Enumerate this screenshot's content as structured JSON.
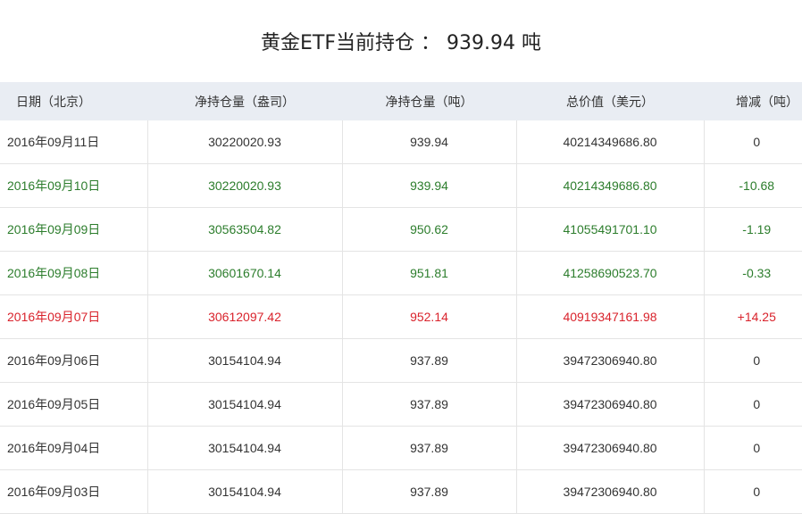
{
  "page_title": "黄金ETF当前持仓 ： 939.94 吨",
  "colors": {
    "header_bg": "#e9edf3",
    "decrease": "#2c7d2c",
    "increase": "#d9232c",
    "neutral": "#333333"
  },
  "table": {
    "headers": [
      "日期（北京）",
      "净持仓量（盎司）",
      "净持仓量（吨）",
      "总价值（美元）",
      "增减（吨）"
    ],
    "rows": [
      {
        "trend": "neutral",
        "cells": [
          "2016年09月11日",
          "30220020.93",
          "939.94",
          "40214349686.80",
          "0"
        ]
      },
      {
        "trend": "down",
        "cells": [
          "2016年09月10日",
          "30220020.93",
          "939.94",
          "40214349686.80",
          "-10.68"
        ]
      },
      {
        "trend": "down",
        "cells": [
          "2016年09月09日",
          "30563504.82",
          "950.62",
          "41055491701.10",
          "-1.19"
        ]
      },
      {
        "trend": "down",
        "cells": [
          "2016年09月08日",
          "30601670.14",
          "951.81",
          "41258690523.70",
          "-0.33"
        ]
      },
      {
        "trend": "up",
        "cells": [
          "2016年09月07日",
          "30612097.42",
          "952.14",
          "40919347161.98",
          "+14.25"
        ]
      },
      {
        "trend": "neutral",
        "cells": [
          "2016年09月06日",
          "30154104.94",
          "937.89",
          "39472306940.80",
          "0"
        ]
      },
      {
        "trend": "neutral",
        "cells": [
          "2016年09月05日",
          "30154104.94",
          "937.89",
          "39472306940.80",
          "0"
        ]
      },
      {
        "trend": "neutral",
        "cells": [
          "2016年09月04日",
          "30154104.94",
          "937.89",
          "39472306940.80",
          "0"
        ]
      },
      {
        "trend": "neutral",
        "cells": [
          "2016年09月03日",
          "30154104.94",
          "937.89",
          "39472306940.80",
          "0"
        ]
      }
    ]
  }
}
